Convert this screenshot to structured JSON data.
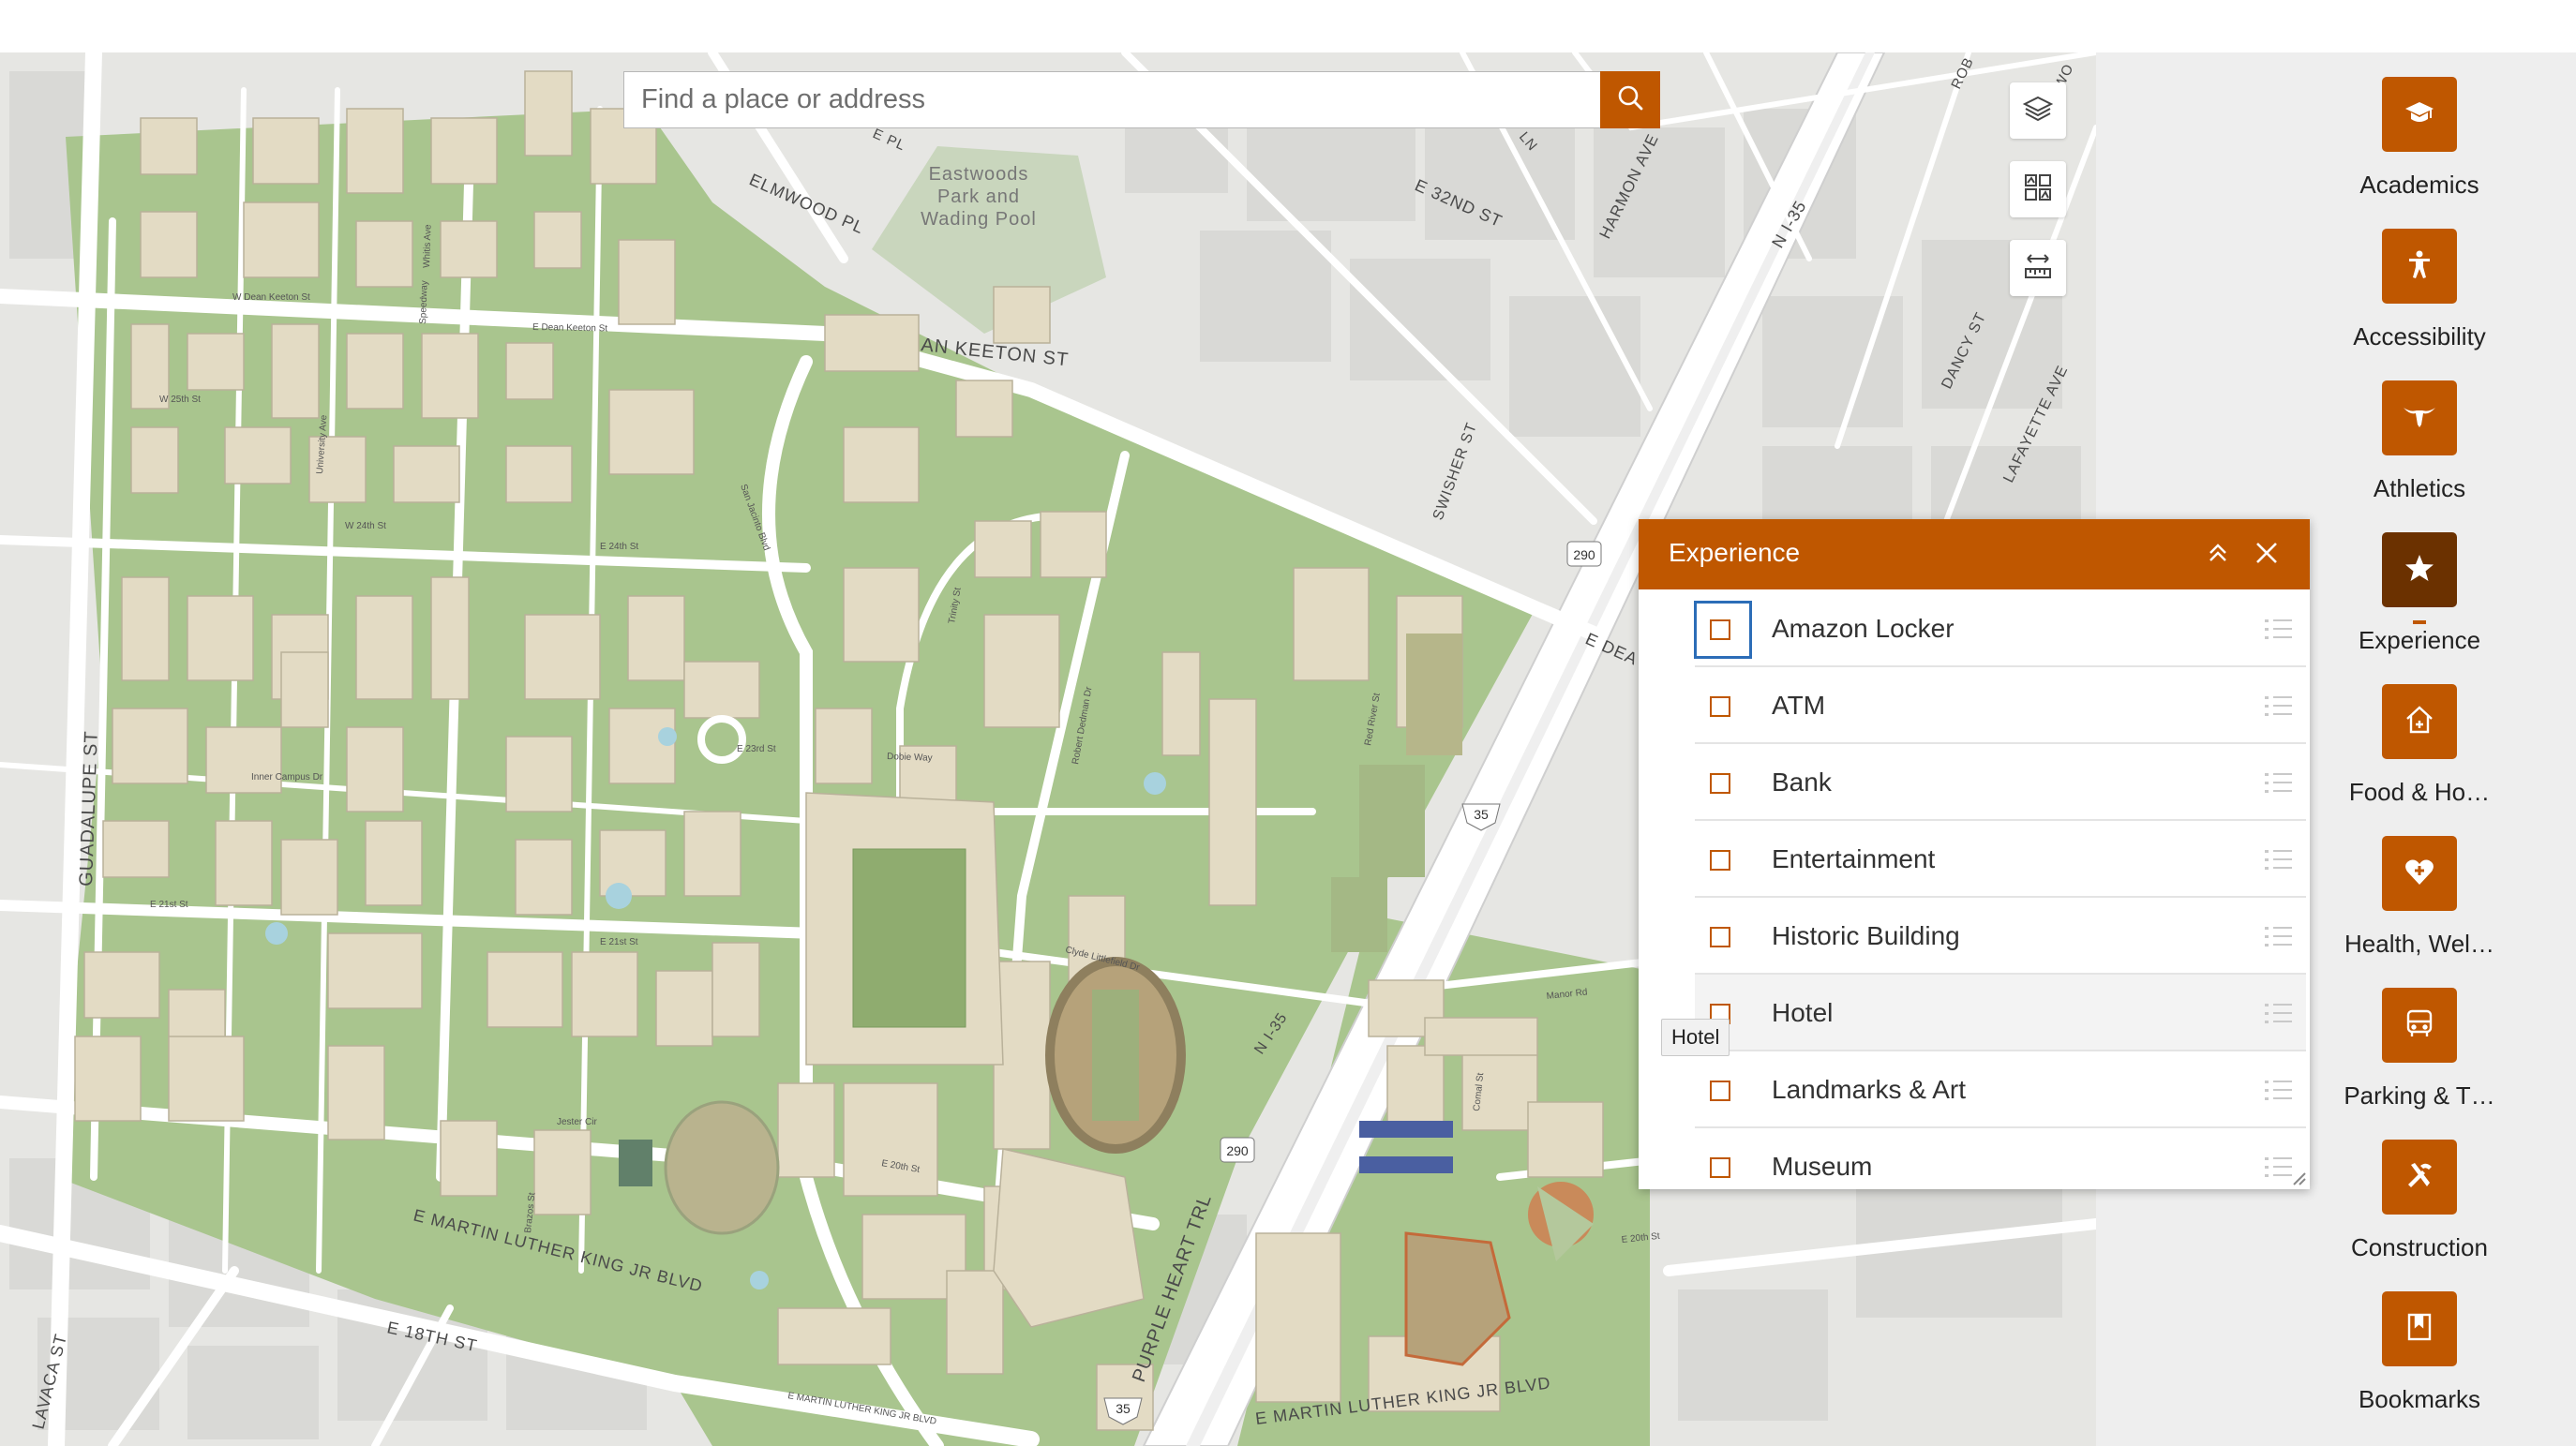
{
  "search": {
    "placeholder": "Find a place or address"
  },
  "map": {
    "labels": {
      "park": [
        "Eastwoods",
        "Park and",
        "Wading Pool"
      ],
      "streets": {
        "an_keeton": "AN KEETON ST",
        "elmwood": "ELMWOOD PL",
        "e32nd": "E 32ND ST",
        "harmon": "HARMON AVE",
        "i35_north": "N I-35",
        "dancy": "DANCY ST",
        "lafayette": "LAFAYETTE AVE",
        "swisher": "SWISHER ST",
        "guadalupe": "GUADALUPE ST",
        "lavaca": "LAVACA ST",
        "e18th": "E 18TH ST",
        "mlk_west": "E MARTIN LUTHER KING JR BLVD",
        "mlk_east": "E MARTIN LUTHER KING JR BLVD",
        "purple_heart": "PURPLE HEART TRL",
        "i35_south": "N I-35",
        "e_dean": "E DEA",
        "dean_keeton_small": "E Dean Keeton St",
        "w_dean_keeton": "W Dean Keeton St",
        "w25th": "W 25th St",
        "w24th": "W 24th St",
        "e24th": "E 24th St",
        "e23rd": "E 23rd St",
        "e21st": "E 21st St",
        "e21st_b": "E 21st St",
        "dobie": "Dobie",
        "inner_campus": "Inner Campus Dr",
        "dobie_way": "Dobie Way",
        "san_jacinto": "San Jacinto Blvd",
        "robert_dedman": "Robert Dedman Dr",
        "red_river": "Red River St",
        "clyde": "Clyde Littlefield Dr",
        "manor": "Manor Rd",
        "e20th": "E 20th St",
        "e20th_b": "E 20th St",
        "jester": "Jester Cir",
        "rob": "ROB",
        "wo": "WO",
        "pl": "E PL",
        "ln": "LN",
        "speedway": "Speedway",
        "whitis": "Whitis Ave",
        "university": "University Ave",
        "trinity": "Trinity St",
        "comal": "Comal St",
        "brazos": "Brazos St"
      },
      "shields": [
        "290",
        "35",
        "290",
        "35"
      ]
    }
  },
  "tools": [
    {
      "name": "layers-icon"
    },
    {
      "name": "basemap-gallery-icon"
    },
    {
      "name": "measure-icon"
    }
  ],
  "nav": {
    "items": [
      {
        "label": "Academics",
        "icon": "mortarboard-icon"
      },
      {
        "label": "Accessibility",
        "icon": "accessibility-icon"
      },
      {
        "label": "Athletics",
        "icon": "longhorn-icon"
      },
      {
        "label": "Experience",
        "icon": "star-icon",
        "active": true
      },
      {
        "label": "Food & Ho…",
        "icon": "house-icon"
      },
      {
        "label": "Health, Wel…",
        "icon": "heart-plus-icon"
      },
      {
        "label": "Parking & T…",
        "icon": "bus-icon"
      },
      {
        "label": "Construction",
        "icon": "tools-icon"
      },
      {
        "label": "Bookmarks",
        "icon": "bookmark-icon"
      }
    ]
  },
  "panel": {
    "title": "Experience",
    "layers": [
      {
        "label": "Amazon Locker",
        "checked": false
      },
      {
        "label": "ATM",
        "checked": false
      },
      {
        "label": "Bank",
        "checked": false
      },
      {
        "label": "Entertainment",
        "checked": false
      },
      {
        "label": "Historic Building",
        "checked": false
      },
      {
        "label": "Hotel",
        "checked": false
      },
      {
        "label": "Landmarks & Art",
        "checked": false
      },
      {
        "label": "Museum",
        "checked": false
      }
    ],
    "tooltip": "Hotel"
  },
  "colors": {
    "accent": "#bf5700",
    "accent_dark": "#6b3100",
    "map_bg": "#e6e6e3",
    "green": "#a9c58e",
    "building": "#e3dbc4"
  }
}
